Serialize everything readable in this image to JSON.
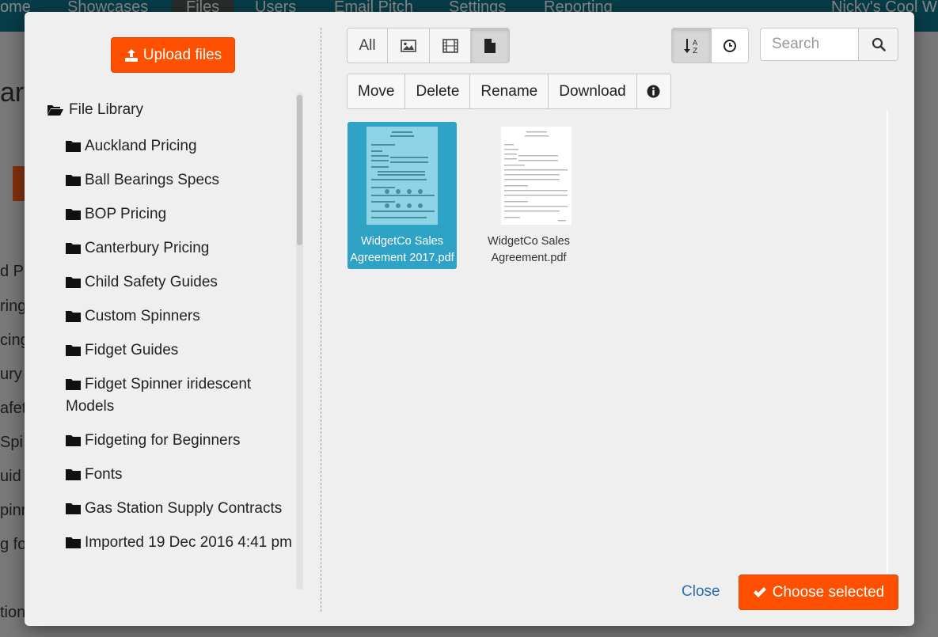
{
  "background": {
    "nav": [
      "ome",
      "Showcases",
      "Files",
      "Users",
      "Email Pitch",
      "Settings",
      "Reporting",
      "Nicky's Cool W"
    ],
    "left_fragments": [
      "ary",
      "d Pr",
      "ring",
      "cing",
      "ury",
      "afety",
      "Spi",
      "uid",
      "pinn",
      "g fo",
      "tion"
    ]
  },
  "modal": {
    "upload_label": "Upload files",
    "tree": {
      "root": "File Library",
      "folders": [
        "Auckland Pricing",
        "Ball Bearings Specs",
        "BOP Pricing",
        "Canterbury Pricing",
        "Child Safety Guides",
        "Custom Spinners",
        "Fidget Guides",
        "Fidget Spinner iridescent Models",
        "Fidgeting for Beginners",
        "Fonts",
        "Gas Station Supply Contracts",
        "Imported 19 Dec 2016 4:41 pm"
      ]
    },
    "filters": {
      "all": "All",
      "image_icon": "image-icon",
      "video_icon": "film-icon",
      "document_icon": "document-icon",
      "active": "document"
    },
    "sort": {
      "alpha_icon": "sort-alpha-icon",
      "time_icon": "clock-icon",
      "active": "alpha"
    },
    "search": {
      "placeholder": "Search",
      "value": ""
    },
    "actions": {
      "move": "Move",
      "delete": "Delete",
      "rename": "Rename",
      "download": "Download",
      "info_icon": "info-icon"
    },
    "files": [
      {
        "name": "WidgetCo Sales Agreement 2017.pdf",
        "selected": true
      },
      {
        "name": "WidgetCo Sales Agreement.pdf",
        "selected": false
      }
    ],
    "footer": {
      "close_label": "Close",
      "choose_label": "Choose selected"
    },
    "colors": {
      "primary": "#fe5000",
      "selected": "#2ea3c6",
      "link": "#2a6fb0"
    }
  }
}
